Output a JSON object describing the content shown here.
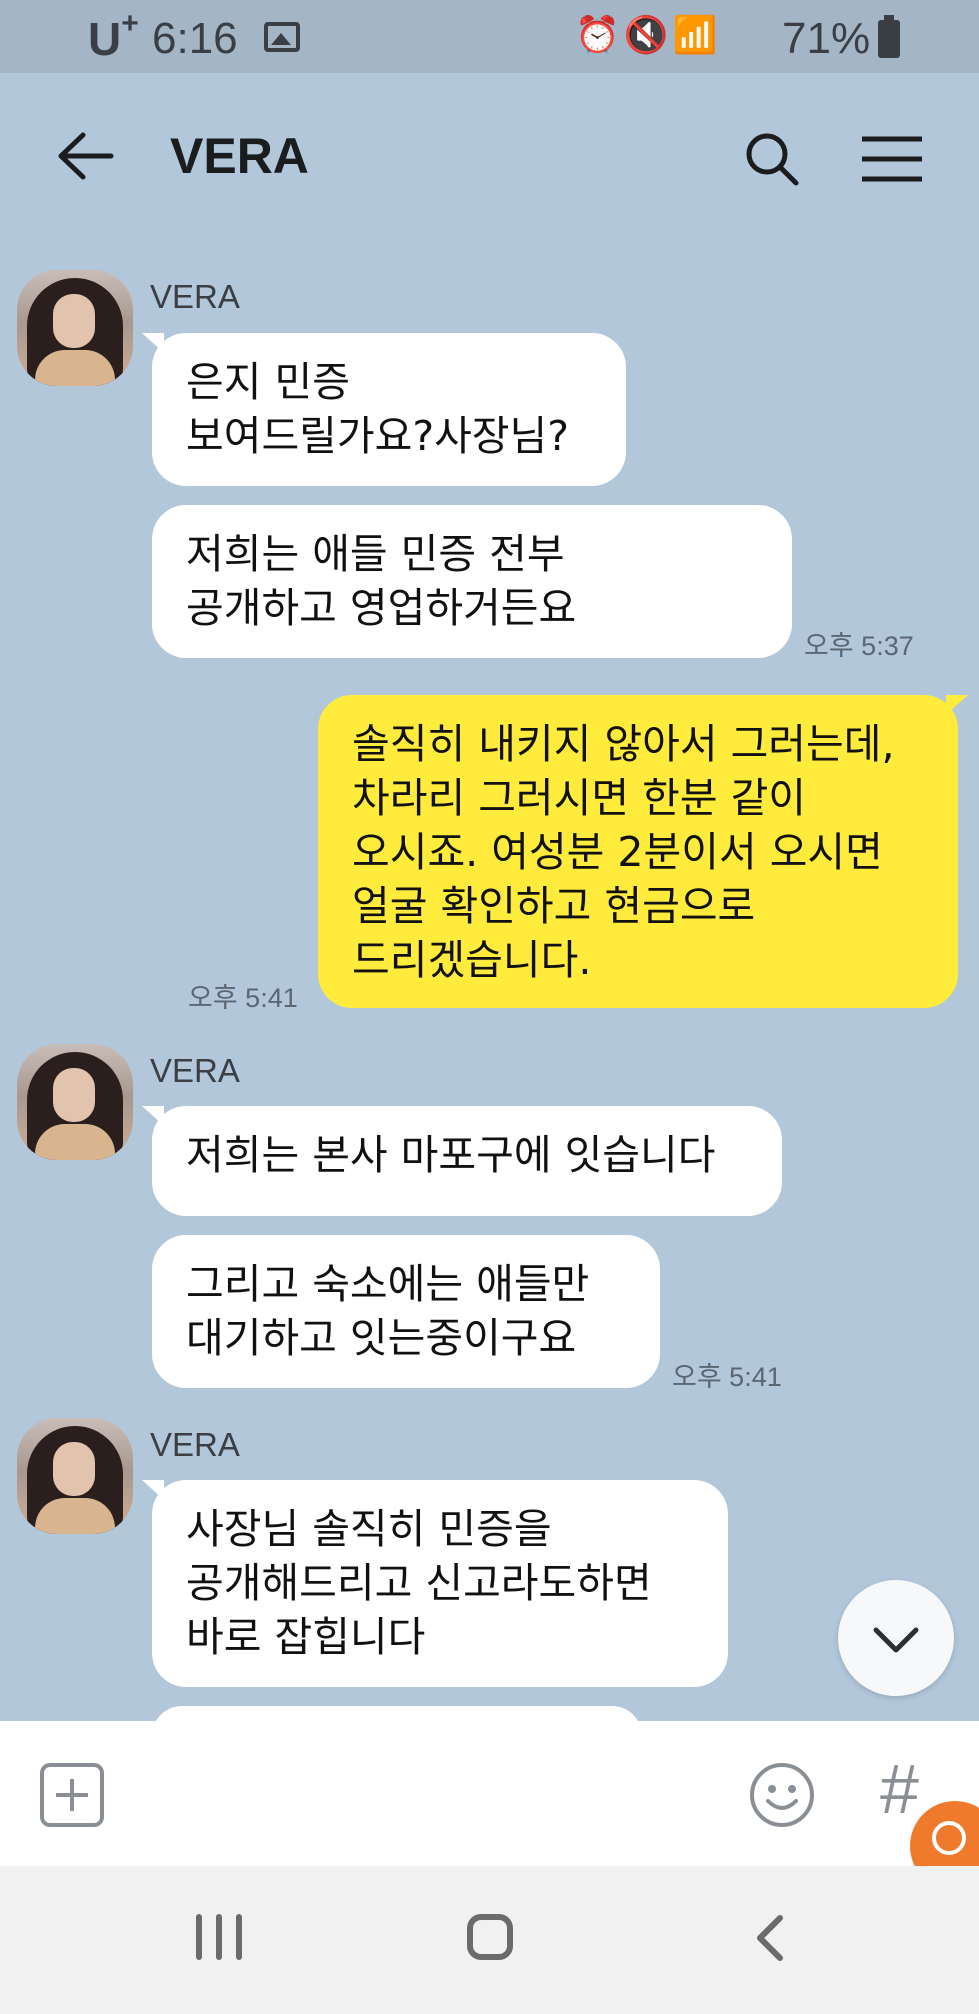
{
  "status_bar": {
    "carrier": "U",
    "carrier_sup": "+",
    "time": "6:16",
    "icons": "⏰🔇📶",
    "battery": "71%"
  },
  "header": {
    "title": "VERA"
  },
  "messages": [
    {
      "sender": "VERA",
      "bubbles": [
        {
          "text": "은지 민증\n보여드릴가요?사장님?"
        },
        {
          "text": "저희는 애들 민증 전부\n공개하고 영업하거든요",
          "time": "오후 5:37"
        }
      ]
    },
    {
      "outgoing": true,
      "text": "솔직히 내키지 않아서 그러는데,\n차라리 그러시면 한분 같이\n오시죠. 여성분 2분이서 오시면\n얼굴 확인하고 현금으로\n드리겠습니다.",
      "time": "오후 5:41"
    },
    {
      "sender": "VERA",
      "bubbles": [
        {
          "text": "저희는 본사 마포구에 잇습니다"
        },
        {
          "text": "그리고 숙소에는 애들만\n대기하고 잇는중이구요",
          "time": "오후 5:41"
        }
      ]
    },
    {
      "sender": "VERA",
      "bubbles": [
        {
          "text": "사장님 솔직히 민증을\n공개해드리고 신고라도하면\n바로 잡힙니다"
        }
      ]
    }
  ],
  "colors": {
    "background": "#b2c7da",
    "incoming_bubble": "#ffffff",
    "outgoing_bubble": "#ffeb3b",
    "badge": "#f07a2c"
  },
  "input_bar": {
    "hash_symbol": "#"
  }
}
